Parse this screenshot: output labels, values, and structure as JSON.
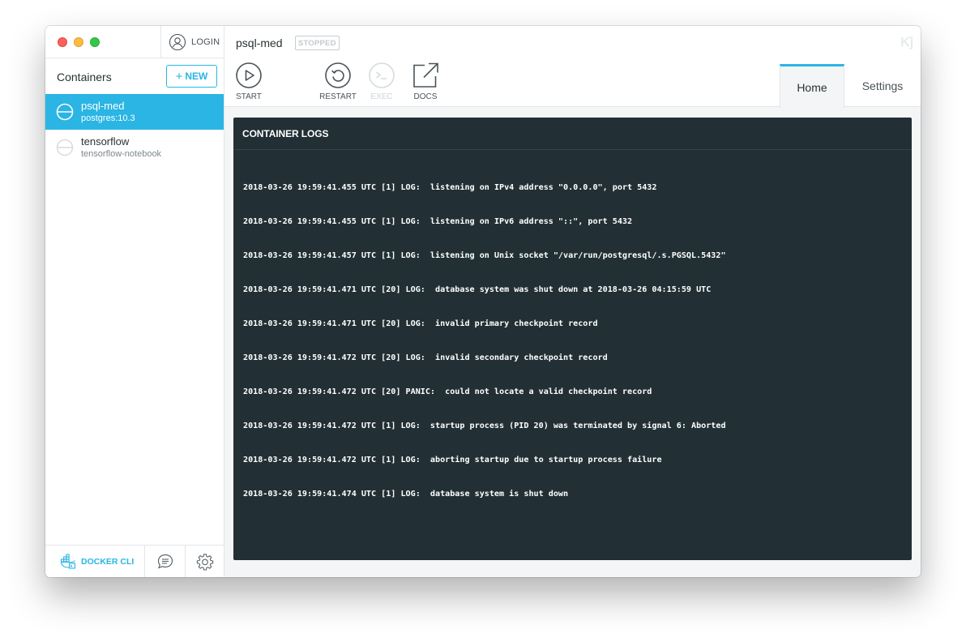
{
  "sidebar": {
    "login_label": "LOGIN",
    "containers_title": "Containers",
    "new_button_label": "NEW",
    "containers": [
      {
        "name": "psql-med",
        "image": "postgres:10.3",
        "active": true
      },
      {
        "name": "tensorflow",
        "image": "tensorflow-notebook",
        "active": false
      }
    ],
    "footer": {
      "docker_cli_label": "DOCKER CLI"
    }
  },
  "header": {
    "container_name": "psql-med",
    "status": "STOPPED",
    "actions": [
      {
        "label": "START",
        "icon": "play-icon",
        "enabled": true
      },
      {
        "label": "RESTART",
        "icon": "restart-icon",
        "enabled": true
      },
      {
        "label": "EXEC",
        "icon": "terminal-icon",
        "enabled": false
      },
      {
        "label": "DOCS",
        "icon": "external-link-icon",
        "enabled": true
      }
    ],
    "tabs": [
      {
        "label": "Home",
        "active": true
      },
      {
        "label": "Settings",
        "active": false
      }
    ]
  },
  "logs": {
    "title": "CONTAINER LOGS",
    "lines": [
      "2018-03-26 19:59:41.455 UTC [1] LOG:  listening on IPv4 address \"0.0.0.0\", port 5432",
      "2018-03-26 19:59:41.455 UTC [1] LOG:  listening on IPv6 address \"::\", port 5432",
      "2018-03-26 19:59:41.457 UTC [1] LOG:  listening on Unix socket \"/var/run/postgresql/.s.PGSQL.5432\"",
      "2018-03-26 19:59:41.471 UTC [20] LOG:  database system was shut down at 2018-03-26 04:15:59 UTC",
      "2018-03-26 19:59:41.471 UTC [20] LOG:  invalid primary checkpoint record",
      "2018-03-26 19:59:41.472 UTC [20] LOG:  invalid secondary checkpoint record",
      "2018-03-26 19:59:41.472 UTC [20] PANIC:  could not locate a valid checkpoint record",
      "2018-03-26 19:59:41.472 UTC [1] LOG:  startup process (PID 20) was terminated by signal 6: Aborted",
      "2018-03-26 19:59:41.472 UTC [1] LOG:  aborting startup due to startup process failure",
      "2018-03-26 19:59:41.474 UTC [1] LOG:  database system is shut down"
    ]
  },
  "colors": {
    "accent": "#2ab5e4",
    "log_background": "#223035",
    "traffic_red": "#fc605c",
    "traffic_yellow": "#fdbc40",
    "traffic_green": "#34c84a"
  }
}
